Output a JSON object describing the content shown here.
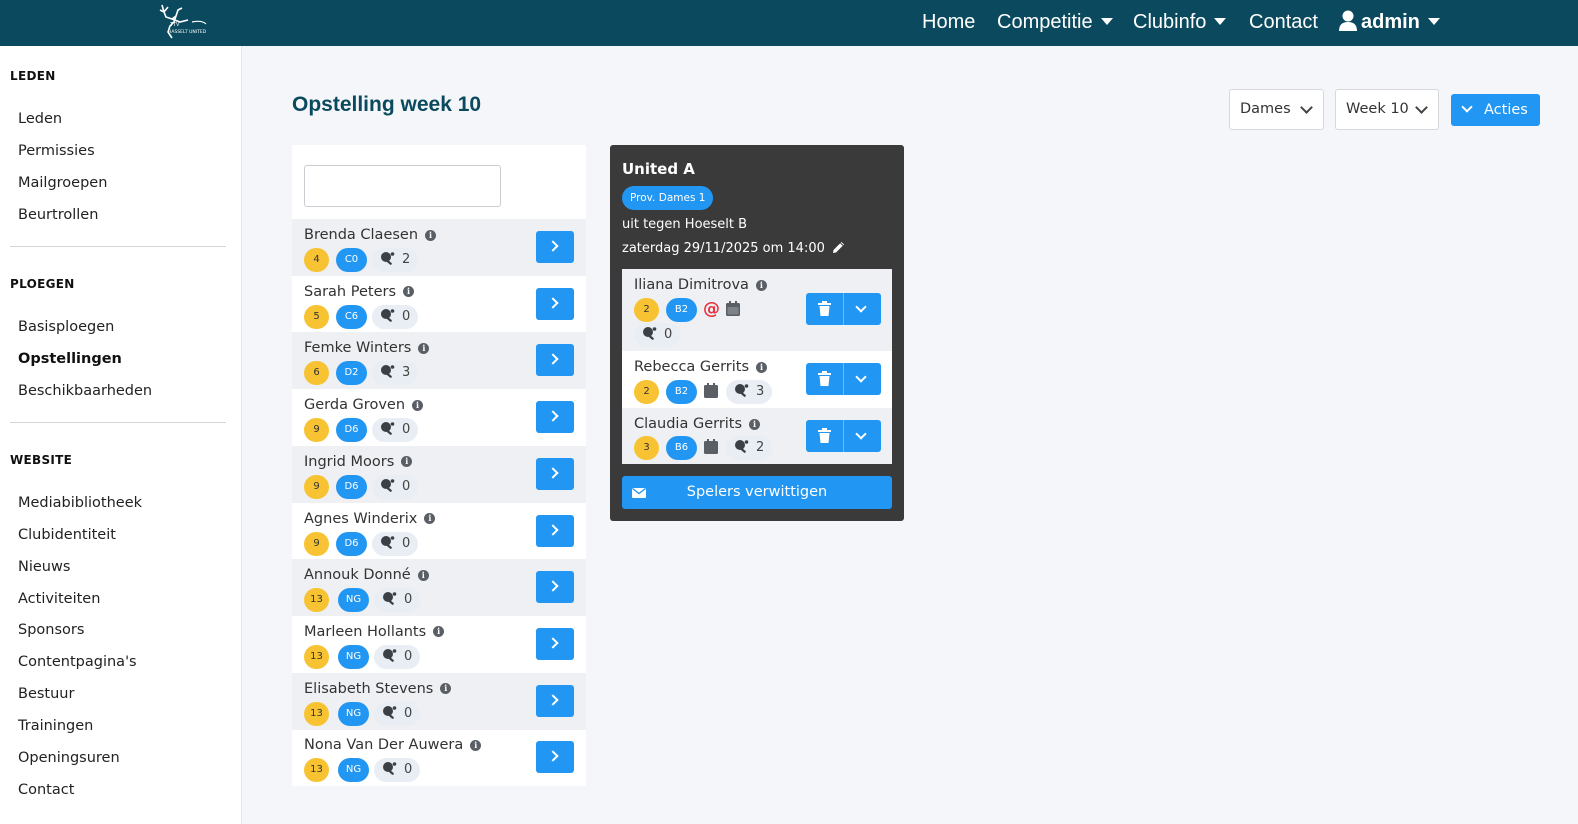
{
  "navbar": {
    "logo_text": "TTV HASSELT UNITED",
    "items": [
      {
        "label": "Home"
      },
      {
        "label": "Competitie"
      },
      {
        "label": "Clubinfo"
      },
      {
        "label": "Contact"
      }
    ],
    "user": {
      "label": "admin"
    }
  },
  "sidebar": {
    "sections": [
      {
        "heading": "LEDEN",
        "items": [
          "Leden",
          "Permissies",
          "Mailgroepen",
          "Beurtrollen"
        ]
      },
      {
        "heading": "PLOEGEN",
        "items": [
          "Basisploegen",
          "Opstellingen",
          "Beschikbaarheden"
        ]
      },
      {
        "heading": "WEBSITE",
        "items": [
          "Mediabibliotheek",
          "Clubidentiteit",
          "Nieuws",
          "Activiteiten",
          "Sponsors",
          "Contentpagina's",
          "Bestuur",
          "Trainingen",
          "Openingsuren",
          "Contact"
        ]
      }
    ],
    "active_item": "Opstellingen"
  },
  "page": {
    "title": "Opstelling week 10",
    "category_select": "Dames",
    "week_select": "Week 10",
    "actions_label": "Acties"
  },
  "search": {
    "value": "",
    "placeholder": ""
  },
  "players": [
    {
      "name": "Brenda Claesen",
      "rank": "4",
      "class": "C0",
      "count": "2"
    },
    {
      "name": "Sarah Peters",
      "rank": "5",
      "class": "C6",
      "count": "0"
    },
    {
      "name": "Femke Winters",
      "rank": "6",
      "class": "D2",
      "count": "3"
    },
    {
      "name": "Gerda Groven",
      "rank": "9",
      "class": "D6",
      "count": "0"
    },
    {
      "name": "Ingrid Moors",
      "rank": "9",
      "class": "D6",
      "count": "0"
    },
    {
      "name": "Agnes Winderix",
      "rank": "9",
      "class": "D6",
      "count": "0"
    },
    {
      "name": "Annouk Donné",
      "rank": "13",
      "class": "NG",
      "count": "0"
    },
    {
      "name": "Marleen Hollants",
      "rank": "13",
      "class": "NG",
      "count": "0"
    },
    {
      "name": "Elisabeth Stevens",
      "rank": "13",
      "class": "NG",
      "count": "0"
    },
    {
      "name": "Nona Van Der Auwera",
      "rank": "13",
      "class": "NG",
      "count": "0"
    }
  ],
  "team": {
    "name": "United A",
    "league": "Prov. Dames 1",
    "opponent_line": "uit tegen Hoeselt B",
    "datetime_line": "zaterdag 29/11/2025 om 14:00",
    "players": [
      {
        "name": "Iliana Dimitrova",
        "rank": "2",
        "class": "B2",
        "count": "0"
      },
      {
        "name": "Rebecca Gerrits",
        "rank": "2",
        "class": "B2",
        "count": "3"
      },
      {
        "name": "Claudia Gerrits",
        "rank": "3",
        "class": "B6",
        "count": "2"
      }
    ],
    "notify_label": "Spelers verwittigen"
  },
  "colors": {
    "navbar": "#0b4a5e",
    "primary": "#2196f3",
    "rank_badge": "#f7c332",
    "card_dark": "#3a3a3a",
    "mention": "#e53341"
  },
  "icons": [
    "info-icon",
    "table-tennis-icon",
    "chevron-right-icon",
    "chevron-down-icon",
    "trash-icon",
    "calendar-icon",
    "at-icon",
    "pencil-icon",
    "envelope-icon",
    "user-icon"
  ]
}
